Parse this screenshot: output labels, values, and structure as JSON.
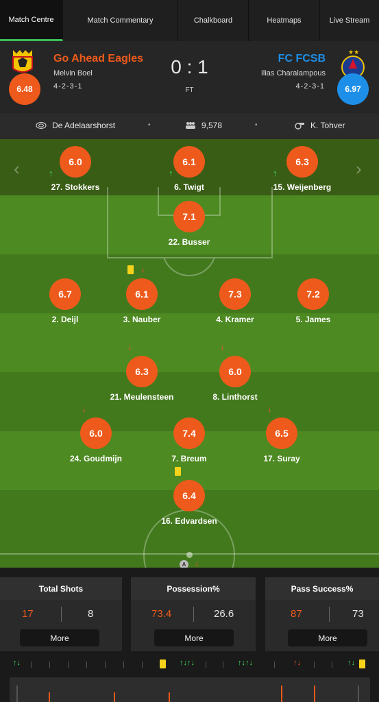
{
  "tabs": [
    "Match Centre",
    "Match Commentary",
    "Chalkboard",
    "Heatmaps",
    "Live Stream"
  ],
  "home": {
    "name": "Go Ahead Eagles",
    "manager": "Melvin Boel",
    "formation": "4-2-3-1",
    "rating": "6.48",
    "color": "#ee5a1c"
  },
  "away": {
    "name": "FC FCSB",
    "manager": "Ilias Charalampous",
    "formation": "4-2-3-1",
    "rating": "6.97",
    "color": "#1d8fe8"
  },
  "score": "0 : 1",
  "status": "FT",
  "info": {
    "stadium": "De Adelaarshorst",
    "attendance": "9,578",
    "referee": "K. Tohver"
  },
  "subs": [
    {
      "rating": "6.0",
      "name": "27. Stokkers"
    },
    {
      "rating": "6.1",
      "name": "6. Twigt"
    },
    {
      "rating": "6.3",
      "name": "15. Weijenberg"
    }
  ],
  "players": [
    {
      "rating": "7.1",
      "name": "22. Busser"
    },
    {
      "rating": "6.7",
      "name": "2. Deijl"
    },
    {
      "rating": "6.1",
      "name": "3. Nauber"
    },
    {
      "rating": "7.3",
      "name": "4. Kramer"
    },
    {
      "rating": "7.2",
      "name": "5. James"
    },
    {
      "rating": "6.3",
      "name": "21. Meulensteen"
    },
    {
      "rating": "6.0",
      "name": "8. Linthorst"
    },
    {
      "rating": "6.0",
      "name": "24. Goudmijn"
    },
    {
      "rating": "7.4",
      "name": "7. Breum"
    },
    {
      "rating": "6.5",
      "name": "17. Suray"
    },
    {
      "rating": "6.4",
      "name": "16. Edvardsen"
    }
  ],
  "assist_marker": "A",
  "stats": [
    {
      "title": "Total Shots",
      "home": "17",
      "away": "8",
      "more": "More"
    },
    {
      "title": "Possession%",
      "home": "73.4",
      "away": "26.6",
      "more": "More"
    },
    {
      "title": "Pass Success%",
      "home": "87",
      "away": "73",
      "more": "More"
    }
  ],
  "icons": {
    "stadium": "stadium-icon",
    "attendance": "crowd-icon",
    "referee": "whistle-icon"
  },
  "colors": {
    "yellow_card": "#f7d21b",
    "sub_in": "#3de05a",
    "sub_out": "#f0532a"
  }
}
